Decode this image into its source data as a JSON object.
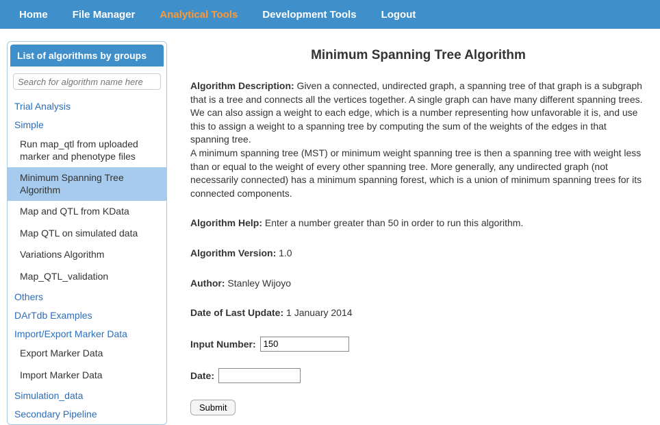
{
  "nav": {
    "items": [
      {
        "label": "Home",
        "active": false
      },
      {
        "label": "File Manager",
        "active": false
      },
      {
        "label": "Analytical Tools",
        "active": true
      },
      {
        "label": "Development Tools",
        "active": false
      },
      {
        "label": "Logout",
        "active": false
      }
    ]
  },
  "sidebar": {
    "header": "List of algorithms by groups",
    "search_placeholder": "Search for algorithm name here",
    "groups": {
      "trial_analysis": "Trial Analysis",
      "simple": "Simple",
      "simple_items": [
        "Run map_qtl from uploaded marker and phenotype files",
        "Minimum Spanning Tree Algorithm",
        "Map and QTL from KData",
        "Map QTL on simulated data",
        "Variations Algorithm",
        "Map_QTL_validation"
      ],
      "others": "Others",
      "dartdb": "DArTdb Examples",
      "import_export": "Import/Export Marker Data",
      "import_export_items": [
        "Export Marker Data",
        "Import Marker Data"
      ],
      "simulation": "Simulation_data",
      "secondary": "Secondary Pipeline"
    }
  },
  "main": {
    "title": "Minimum Spanning Tree Algorithm",
    "desc_label": "Algorithm Description:",
    "desc_text1": " Given a connected, undirected graph, a spanning tree of that graph is a subgraph that is a tree and connects all the vertices together. A single graph can have many different spanning trees. We can also assign a weight to each edge, which is a number representing how unfavorable it is, and use this to assign a weight to a spanning tree by computing the sum of the weights of the edges in that spanning tree.",
    "desc_text2": "A minimum spanning tree (MST) or minimum weight spanning tree is then a spanning tree with weight less than or equal to the weight of every other spanning tree. More generally, any undirected graph (not necessarily connected) has a minimum spanning forest, which is a union of minimum spanning trees for its connected components.",
    "help_label": "Algorithm Help:",
    "help_text": " Enter a number greater than 50 in order to run this algorithm.",
    "version_label": "Algorithm Version:",
    "version_text": " 1.0",
    "author_label": "Author:",
    "author_text": " Stanley Wijoyo",
    "date_label": "Date of Last Update:",
    "date_text": " 1 January 2014",
    "input_number_label": "Input Number:",
    "input_number_value": "150",
    "input_date_label": "Date:",
    "input_date_value": "",
    "submit_label": "Submit"
  }
}
